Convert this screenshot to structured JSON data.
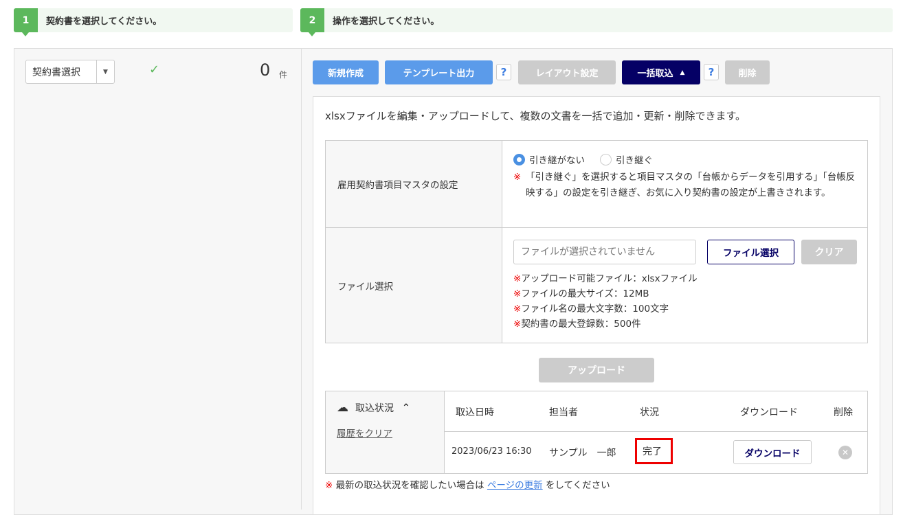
{
  "steps": [
    {
      "num": "1",
      "text": "契約書を選択してください。"
    },
    {
      "num": "2",
      "text": "操作を選択してください。"
    }
  ],
  "left": {
    "select_label": "契約書選択",
    "count": "0",
    "count_unit": "件"
  },
  "toolbar": {
    "new": "新規作成",
    "template": "テンプレート出力",
    "help": "?",
    "layout": "レイアウト設定",
    "bulk": "一括取込",
    "delete": "削除"
  },
  "description": "xlsxファイルを編集・アップロードして、複数の文書を一括で追加・更新・削除できます。",
  "settings": {
    "master_label": "雇用契約書項目マスタの設定",
    "radio_options": [
      "引き継がない",
      "引き継ぐ"
    ],
    "selected": "引き継がない",
    "master_note": "「引き継ぐ」を選択すると項目マスタの「台帳からデータを引用する」「台帳反映する」の設定を引き継ぎ、お気に入り契約書の設定が上書きされます。",
    "file_label": "ファイル選択",
    "file_placeholder": "ファイルが選択されていません",
    "file_select_btn": "ファイル選択",
    "clear_btn": "クリア",
    "file_notes": [
      "アップロード可能ファイル：xlsxファイル",
      "ファイルの最大サイズ：12MB",
      "ファイル名の最大文字数：100文字",
      "契約書の最大登録数：500件"
    ],
    "mark": "※"
  },
  "upload_btn": "アップロード",
  "status": {
    "title": "取込状況",
    "clear_history": "履歴をクリア",
    "headers": [
      "取込日時",
      "担当者",
      "状況",
      "ダウンロード",
      "削除"
    ],
    "rows": [
      {
        "datetime": "2023/06/23 16:30",
        "user": "サンプル　一郎",
        "state": "完了",
        "download": "ダウンロード"
      }
    ]
  },
  "footer": {
    "mark": "※",
    "pre": "最新の取込状況を確認したい場合は",
    "link": "ページの更新",
    "post": "をしてください"
  },
  "colors": {
    "accent": "#5b9bea",
    "navy": "#050065",
    "green": "#5cb85c",
    "highlight": "#e00000"
  }
}
